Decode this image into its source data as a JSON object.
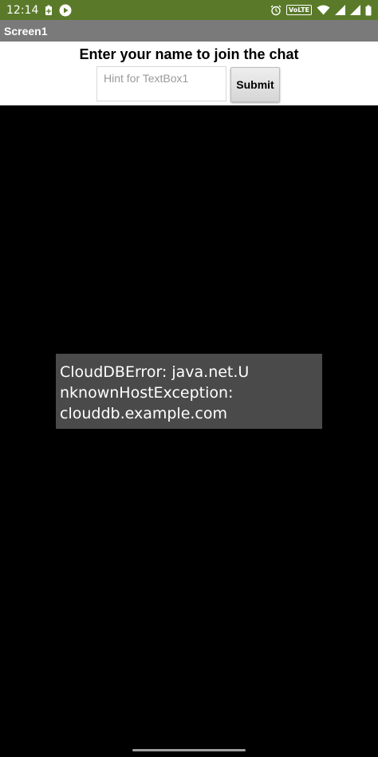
{
  "status_bar": {
    "time": "12:14",
    "network_label": "VoLTE",
    "background_color": "#5a7a2a",
    "left_icons": [
      "battery-saver-icon",
      "play-icon"
    ],
    "right_icons": [
      "alarm-icon",
      "volte-icon",
      "wifi-icon",
      "signal-icon",
      "signal-icon",
      "battery-icon"
    ]
  },
  "app": {
    "title": "Screen1",
    "title_bar_color": "#7a7a7a"
  },
  "form": {
    "heading": "Enter your name to join the chat",
    "name_input": {
      "value": "",
      "placeholder": "Hint for TextBox1"
    },
    "submit_label": "Submit"
  },
  "error_toast": {
    "lines": [
      "CloudDBError: java.net.U",
      "nknownHostException:",
      "clouddb.example.com"
    ],
    "background_color": "#4a4a4a"
  }
}
